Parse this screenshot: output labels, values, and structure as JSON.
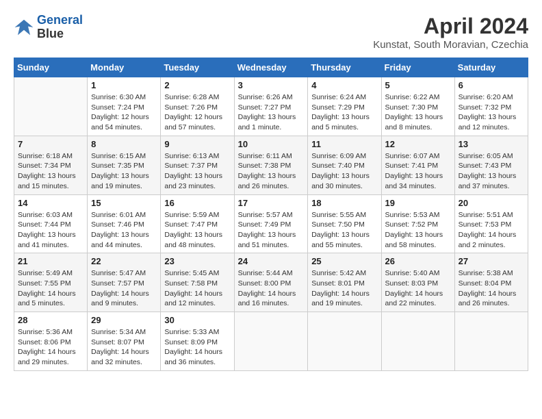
{
  "logo": {
    "line1": "General",
    "line2": "Blue"
  },
  "title": "April 2024",
  "location": "Kunstat, South Moravian, Czechia",
  "weekdays": [
    "Sunday",
    "Monday",
    "Tuesday",
    "Wednesday",
    "Thursday",
    "Friday",
    "Saturday"
  ],
  "weeks": [
    [
      {
        "day": "",
        "info": ""
      },
      {
        "day": "1",
        "info": "Sunrise: 6:30 AM\nSunset: 7:24 PM\nDaylight: 12 hours\nand 54 minutes."
      },
      {
        "day": "2",
        "info": "Sunrise: 6:28 AM\nSunset: 7:26 PM\nDaylight: 12 hours\nand 57 minutes."
      },
      {
        "day": "3",
        "info": "Sunrise: 6:26 AM\nSunset: 7:27 PM\nDaylight: 13 hours\nand 1 minute."
      },
      {
        "day": "4",
        "info": "Sunrise: 6:24 AM\nSunset: 7:29 PM\nDaylight: 13 hours\nand 5 minutes."
      },
      {
        "day": "5",
        "info": "Sunrise: 6:22 AM\nSunset: 7:30 PM\nDaylight: 13 hours\nand 8 minutes."
      },
      {
        "day": "6",
        "info": "Sunrise: 6:20 AM\nSunset: 7:32 PM\nDaylight: 13 hours\nand 12 minutes."
      }
    ],
    [
      {
        "day": "7",
        "info": "Sunrise: 6:18 AM\nSunset: 7:34 PM\nDaylight: 13 hours\nand 15 minutes."
      },
      {
        "day": "8",
        "info": "Sunrise: 6:15 AM\nSunset: 7:35 PM\nDaylight: 13 hours\nand 19 minutes."
      },
      {
        "day": "9",
        "info": "Sunrise: 6:13 AM\nSunset: 7:37 PM\nDaylight: 13 hours\nand 23 minutes."
      },
      {
        "day": "10",
        "info": "Sunrise: 6:11 AM\nSunset: 7:38 PM\nDaylight: 13 hours\nand 26 minutes."
      },
      {
        "day": "11",
        "info": "Sunrise: 6:09 AM\nSunset: 7:40 PM\nDaylight: 13 hours\nand 30 minutes."
      },
      {
        "day": "12",
        "info": "Sunrise: 6:07 AM\nSunset: 7:41 PM\nDaylight: 13 hours\nand 34 minutes."
      },
      {
        "day": "13",
        "info": "Sunrise: 6:05 AM\nSunset: 7:43 PM\nDaylight: 13 hours\nand 37 minutes."
      }
    ],
    [
      {
        "day": "14",
        "info": "Sunrise: 6:03 AM\nSunset: 7:44 PM\nDaylight: 13 hours\nand 41 minutes."
      },
      {
        "day": "15",
        "info": "Sunrise: 6:01 AM\nSunset: 7:46 PM\nDaylight: 13 hours\nand 44 minutes."
      },
      {
        "day": "16",
        "info": "Sunrise: 5:59 AM\nSunset: 7:47 PM\nDaylight: 13 hours\nand 48 minutes."
      },
      {
        "day": "17",
        "info": "Sunrise: 5:57 AM\nSunset: 7:49 PM\nDaylight: 13 hours\nand 51 minutes."
      },
      {
        "day": "18",
        "info": "Sunrise: 5:55 AM\nSunset: 7:50 PM\nDaylight: 13 hours\nand 55 minutes."
      },
      {
        "day": "19",
        "info": "Sunrise: 5:53 AM\nSunset: 7:52 PM\nDaylight: 13 hours\nand 58 minutes."
      },
      {
        "day": "20",
        "info": "Sunrise: 5:51 AM\nSunset: 7:53 PM\nDaylight: 14 hours\nand 2 minutes."
      }
    ],
    [
      {
        "day": "21",
        "info": "Sunrise: 5:49 AM\nSunset: 7:55 PM\nDaylight: 14 hours\nand 5 minutes."
      },
      {
        "day": "22",
        "info": "Sunrise: 5:47 AM\nSunset: 7:57 PM\nDaylight: 14 hours\nand 9 minutes."
      },
      {
        "day": "23",
        "info": "Sunrise: 5:45 AM\nSunset: 7:58 PM\nDaylight: 14 hours\nand 12 minutes."
      },
      {
        "day": "24",
        "info": "Sunrise: 5:44 AM\nSunset: 8:00 PM\nDaylight: 14 hours\nand 16 minutes."
      },
      {
        "day": "25",
        "info": "Sunrise: 5:42 AM\nSunset: 8:01 PM\nDaylight: 14 hours\nand 19 minutes."
      },
      {
        "day": "26",
        "info": "Sunrise: 5:40 AM\nSunset: 8:03 PM\nDaylight: 14 hours\nand 22 minutes."
      },
      {
        "day": "27",
        "info": "Sunrise: 5:38 AM\nSunset: 8:04 PM\nDaylight: 14 hours\nand 26 minutes."
      }
    ],
    [
      {
        "day": "28",
        "info": "Sunrise: 5:36 AM\nSunset: 8:06 PM\nDaylight: 14 hours\nand 29 minutes."
      },
      {
        "day": "29",
        "info": "Sunrise: 5:34 AM\nSunset: 8:07 PM\nDaylight: 14 hours\nand 32 minutes."
      },
      {
        "day": "30",
        "info": "Sunrise: 5:33 AM\nSunset: 8:09 PM\nDaylight: 14 hours\nand 36 minutes."
      },
      {
        "day": "",
        "info": ""
      },
      {
        "day": "",
        "info": ""
      },
      {
        "day": "",
        "info": ""
      },
      {
        "day": "",
        "info": ""
      }
    ]
  ]
}
